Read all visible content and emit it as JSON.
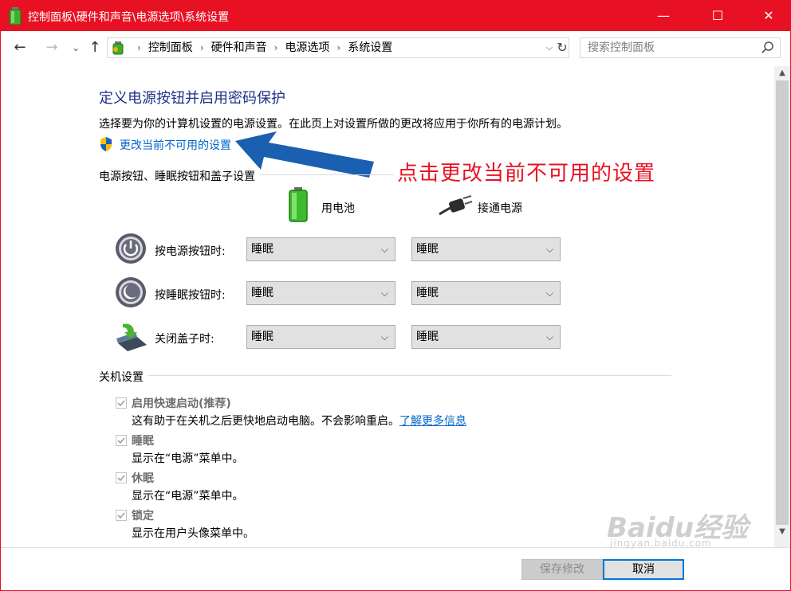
{
  "window": {
    "title": "控制面板\\硬件和声音\\电源选项\\系统设置",
    "accent_color": "#e81123",
    "controls": {
      "minimize": "—",
      "maximize": "☐",
      "close": "✕"
    }
  },
  "address": {
    "breadcrumbs": [
      "控制面板",
      "硬件和声音",
      "电源选项",
      "系统设置"
    ],
    "search_placeholder": "搜索控制面板"
  },
  "main": {
    "heading": "定义电源按钮并启用密码保护",
    "description": "选择要为你的计算机设置的电源设置。在此页上对设置所做的更改将应用于你所有的电源计划。",
    "change_link": "更改当前不可用的设置",
    "annotation": "点击更改当前不可用的设置",
    "annotation_color": "#e81123",
    "power_group_label": "电源按钮、睡眠按钮和盖子设置",
    "columns": {
      "battery": "用电池",
      "plugged": "接通电源"
    },
    "rows": [
      {
        "label": "按电源按钮时:",
        "icon": "power-button-icon",
        "battery": "睡眠",
        "plugged": "睡眠"
      },
      {
        "label": "按睡眠按钮时:",
        "icon": "sleep-button-icon",
        "battery": "睡眠",
        "plugged": "睡眠"
      },
      {
        "label": "关闭盖子时:",
        "icon": "laptop-lid-icon",
        "battery": "睡眠",
        "plugged": "睡眠"
      }
    ],
    "shutdown_group_label": "关机设置",
    "shutdown_options": [
      {
        "label": "启用快速启动(推荐)",
        "desc": "这有助于在关机之后更快地启动电脑。不会影响重启。",
        "link": "了解更多信息",
        "checked": true
      },
      {
        "label": "睡眠",
        "desc": "显示在“电源”菜单中。",
        "checked": true
      },
      {
        "label": "休眠",
        "desc": "显示在“电源”菜单中。",
        "checked": true
      },
      {
        "label": "锁定",
        "desc": "显示在用户头像菜单中。",
        "checked": true
      }
    ]
  },
  "footer": {
    "save": "保存修改",
    "cancel": "取消"
  },
  "watermark": {
    "text": "Baidu经验",
    "sub": "jingyan.baidu.com"
  }
}
